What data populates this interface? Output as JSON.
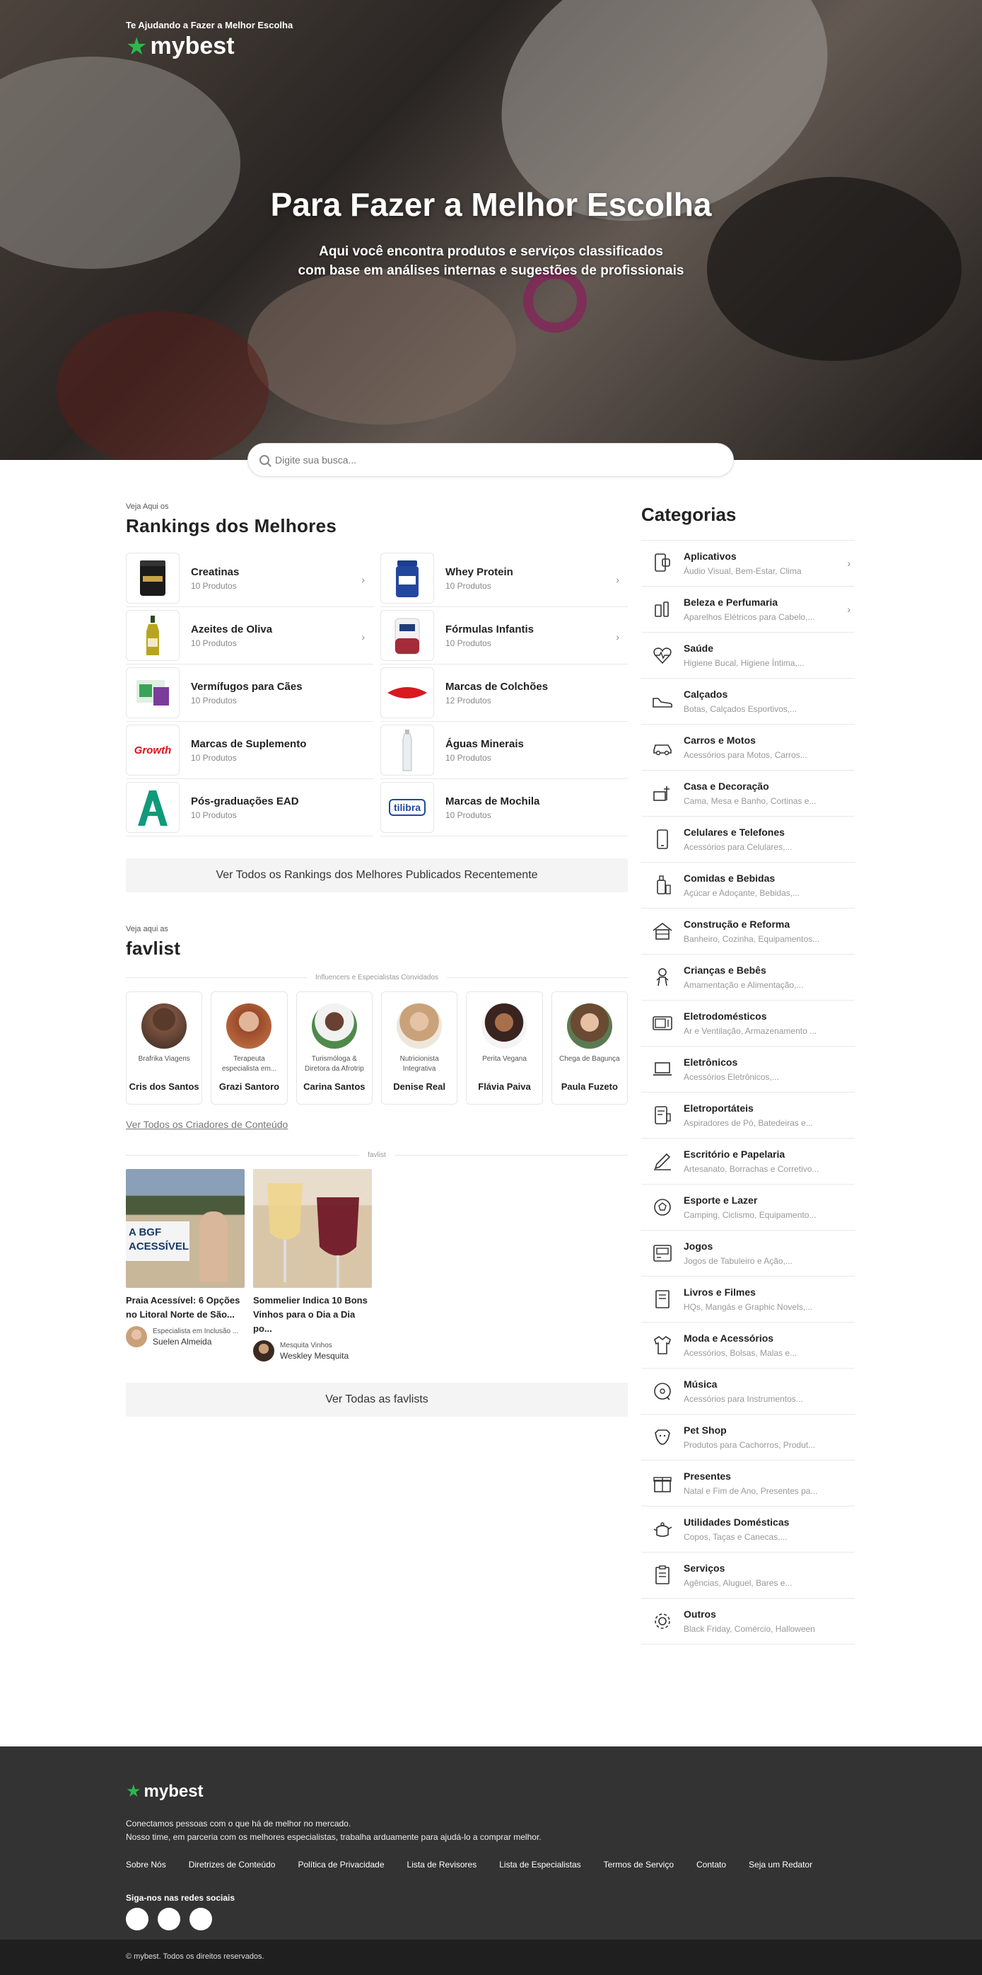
{
  "hero": {
    "tagline": "Te Ajudando a Fazer a Melhor Escolha",
    "logo": "mybest",
    "title": "Para Fazer a Melhor Escolha",
    "subtitle_1": "Aqui você encontra produtos e serviços classificados",
    "subtitle_2": "com base em análises internas e sugestões de profissionais"
  },
  "search": {
    "placeholder": "Digite sua busca..."
  },
  "rankings": {
    "eyebrow": "Veja Aqui os",
    "title": "Rankings dos Melhores",
    "items": [
      {
        "name": "Creatinas",
        "count": "10 Produtos"
      },
      {
        "name": "Whey Protein",
        "count": "10 Produtos"
      },
      {
        "name": "Azeites de Oliva",
        "count": "10 Produtos"
      },
      {
        "name": "Fórmulas Infantis",
        "count": "10 Produtos"
      },
      {
        "name": "Vermífugos para Cães",
        "count": "10 Produtos"
      },
      {
        "name": "Marcas de Colchões",
        "count": "12 Produtos"
      },
      {
        "name": "Marcas de Suplemento",
        "count": "10 Produtos"
      },
      {
        "name": "Águas Minerais",
        "count": "10 Produtos"
      },
      {
        "name": "Pós-graduações EAD",
        "count": "10 Produtos"
      },
      {
        "name": "Marcas de Mochila",
        "count": "10 Produtos"
      }
    ],
    "thumb_labels": {
      "growth": "Growth",
      "tilibra": "tilibra"
    },
    "view_all": "Ver Todos os Rankings dos Melhores Publicados Recentemente"
  },
  "favlist": {
    "eyebrow": "Veja aqui as",
    "title": "favlist",
    "influencers_label": "Influencers e Especialistas Convidados",
    "influencers": [
      {
        "role": "Brafrika Viagens",
        "name": "Cris dos Santos"
      },
      {
        "role": "Terapeuta especialista em...",
        "name": "Grazi Santoro"
      },
      {
        "role": "Turismóloga & Diretora da Afrotrip",
        "name": "Carina Santos"
      },
      {
        "role": "Nutricionista Integrativa",
        "name": "Denise Real"
      },
      {
        "role": "Perita Vegana",
        "name": "Flávia Paiva"
      },
      {
        "role": "Chega de Bagunça",
        "name": "Paula Fuzeto"
      }
    ],
    "view_creators": "Ver Todos os Criadores de Conteúdo",
    "favlist_label": "favlist",
    "cards": [
      {
        "title_1": "Praia Acessível: 6 Opções",
        "title_2": "no Litoral Norte de São...",
        "role": "Especialista em Inclusão ...",
        "author": "Suelen Almeida",
        "img_text_1": "A BGF",
        "img_text_2": "ACESSÍVEL"
      },
      {
        "title_1": "Sommelier Indica 10 Bons",
        "title_2": "Vinhos para o Dia a Dia po...",
        "role": "Mesquita Vinhos",
        "author": "Weskley Mesquita"
      }
    ],
    "view_all": "Ver Todas as favlists"
  },
  "categories": {
    "title": "Categorias",
    "items": [
      {
        "name": "Aplicativos",
        "sub": "Áudio Visual, Bem-Estar, Clima",
        "icon": "phone-app-icon"
      },
      {
        "name": "Beleza e Perfumaria",
        "sub": "Aparelhos Elétricos para Cabelo,...",
        "icon": "perfume-icon"
      },
      {
        "name": "Saúde",
        "sub": "Higiene Bucal, Higiene Íntima,...",
        "icon": "heart-pulse-icon"
      },
      {
        "name": "Calçados",
        "sub": "Botas, Calçados Esportivos,...",
        "icon": "shoe-icon"
      },
      {
        "name": "Carros e Motos",
        "sub": "Acessórios para Motos, Carros...",
        "icon": "car-icon"
      },
      {
        "name": "Casa e Decoração",
        "sub": "Cama, Mesa e Banho, Cortinas e...",
        "icon": "home-decor-icon"
      },
      {
        "name": "Celulares e Telefones",
        "sub": "Acessórios para Celulares,...",
        "icon": "smartphone-icon"
      },
      {
        "name": "Comidas e Bebidas",
        "sub": "Açúcar e Adoçante, Bebidas,...",
        "icon": "bottle-icon"
      },
      {
        "name": "Construção e Reforma",
        "sub": "Banheiro, Cozinha, Equipamentos...",
        "icon": "house-icon"
      },
      {
        "name": "Crianças e Bebês",
        "sub": "Amamentação e Alimentação,...",
        "icon": "baby-icon"
      },
      {
        "name": "Eletrodomésticos",
        "sub": "Ar e Ventilação, Armazenamento ...",
        "icon": "microwave-icon"
      },
      {
        "name": "Eletrônicos",
        "sub": "Acessórios Eletrônicos,...",
        "icon": "laptop-icon"
      },
      {
        "name": "Eletroportáteis",
        "sub": "Aspiradores de Pó, Batedeiras e...",
        "icon": "appliance-icon"
      },
      {
        "name": "Escritório e Papelaria",
        "sub": "Artesanato, Borrachas e Corretivo...",
        "icon": "pen-icon"
      },
      {
        "name": "Esporte e Lazer",
        "sub": "Camping, Ciclismo, Equipamento...",
        "icon": "ball-icon"
      },
      {
        "name": "Jogos",
        "sub": "Jogos de Tabuleiro e Ação,...",
        "icon": "gamepad-icon"
      },
      {
        "name": "Livros e Filmes",
        "sub": "HQs, Mangás e Graphic Novels,...",
        "icon": "book-icon"
      },
      {
        "name": "Moda e Acessórios",
        "sub": "Acessórios, Bolsas, Malas e...",
        "icon": "shirt-icon"
      },
      {
        "name": "Música",
        "sub": "Acessórios para Instrumentos...",
        "icon": "music-icon"
      },
      {
        "name": "Pet Shop",
        "sub": "Produtos para Cachorros, Produt...",
        "icon": "dog-icon"
      },
      {
        "name": "Presentes",
        "sub": "Natal e Fim de Ano, Presentes pa...",
        "icon": "gift-icon"
      },
      {
        "name": "Utilidades Domésticas",
        "sub": "Copos, Taças e Canecas,...",
        "icon": "teapot-icon"
      },
      {
        "name": "Serviços",
        "sub": "Agências, Aluguel, Bares e...",
        "icon": "clipboard-icon"
      },
      {
        "name": "Outros",
        "sub": "Black Friday, Comércio, Halloween",
        "icon": "gear-icon"
      }
    ]
  },
  "footer": {
    "logo": "mybest",
    "desc_1": "Conectamos pessoas com o que há de melhor no mercado.",
    "desc_2": "Nosso time, em parceria com os melhores especialistas, trabalha arduamente para ajudá-lo a comprar melhor.",
    "links": [
      "Sobre Nós",
      "Diretrizes de Conteúdo",
      "Política de Privacidade",
      "Lista de Revisores",
      "Lista de Especialistas",
      "Termos de Serviço",
      "Contato",
      "Seja um Redator"
    ],
    "social_label": "Siga-nos nas redes sociais",
    "copyright": "© mybest. Todos os direitos reservados."
  },
  "colors": {
    "brand_green": "#2bb84e",
    "footer_bg": "#333333",
    "button_bg": "#f4f4f4"
  }
}
